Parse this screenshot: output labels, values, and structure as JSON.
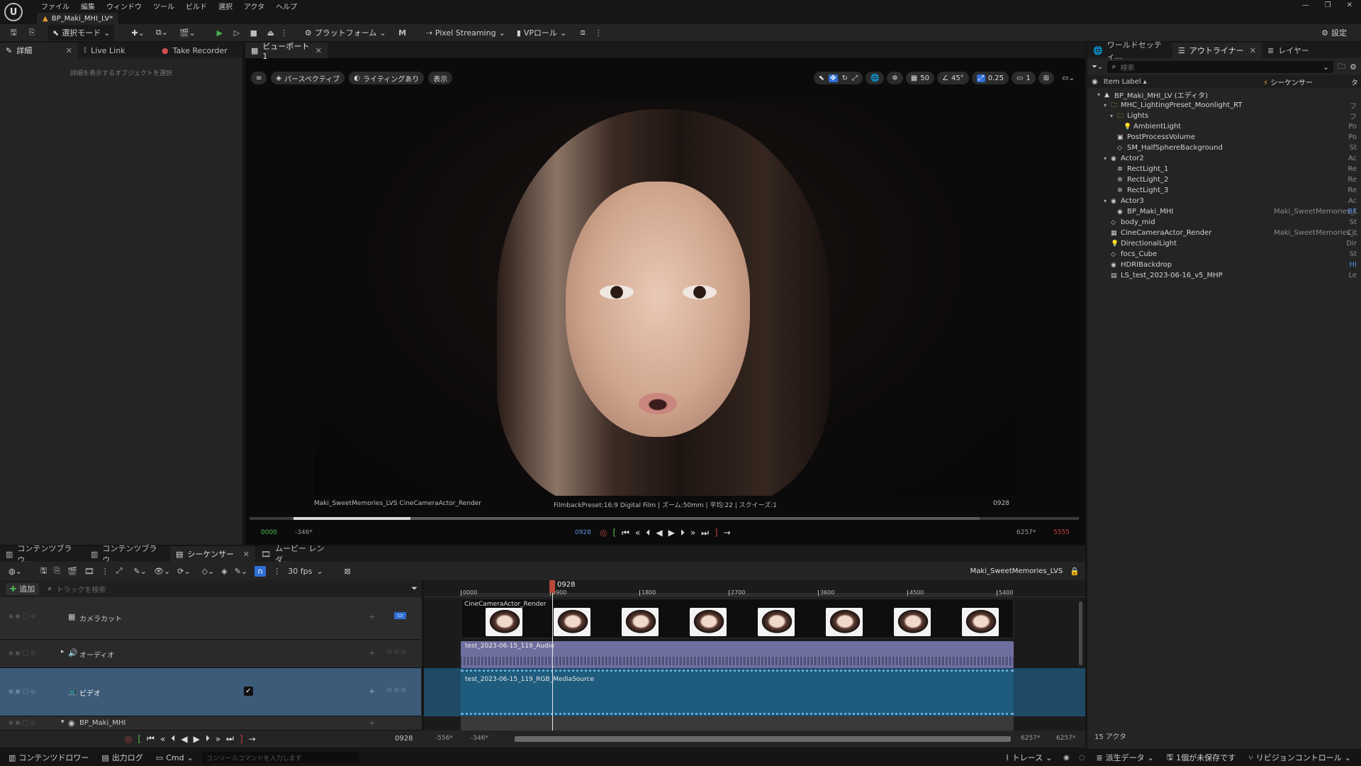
{
  "menu": [
    "ファイル",
    "編集",
    "ウィンドウ",
    "ツール",
    "ビルド",
    "選択",
    "アクタ",
    "ヘルプ"
  ],
  "doc_tab": "BP_Maki_MHI_LV*",
  "toolbar": {
    "select_mode": "選択モード",
    "platform": "プラットフォーム",
    "pixel_streaming": "Pixel Streaming",
    "vp_roll": "VPロール",
    "settings": "設定"
  },
  "left_panel": {
    "tabs": [
      "詳細",
      "Live Link",
      "Take Recorder"
    ],
    "empty_text": "詳細を表示するオブジェクトを選択"
  },
  "viewport": {
    "tab": "ビューポート1",
    "perspective": "パースペクティブ",
    "lighting": "ライティングあり",
    "show": "表示",
    "grid_snap": "50",
    "rot_snap": "45°",
    "scale_snap": "0.25",
    "cam_speed": "1",
    "overlay_left": "Maki_SweetMemories_LVS  CineCameraActor_Render",
    "overlay_center": "FilmbackPreset:16:9 Digital Film | ズーム:50mm | 平均:22 | スクイーズ:1",
    "overlay_right": "0928",
    "frame_start": "0000",
    "frame_view_start": "-346*",
    "current_frame": "0928",
    "frame_view_end": "6257*",
    "frame_end": "5555",
    "scrub_progress": 0.17
  },
  "outliner": {
    "tabs": [
      "ワールドセッティ...",
      "アウトライナー",
      "レイヤー"
    ],
    "search_placeholder": "検索",
    "col_label": "Item Label",
    "col_sequencer": "シーケンサー",
    "col_type": "タ",
    "items": [
      {
        "label": "BP_Maki_MHI_LV (エディタ)",
        "depth": 0,
        "icon": "level",
        "src": "",
        "type": ""
      },
      {
        "label": "MHC_LightingPreset_Moonlight_RT",
        "depth": 1,
        "icon": "folder",
        "src": "",
        "type": "フ"
      },
      {
        "label": "Lights",
        "depth": 2,
        "icon": "folder",
        "src": "",
        "type": "フ"
      },
      {
        "label": "AmbientLight",
        "depth": 3,
        "icon": "light",
        "src": "",
        "type": "Po"
      },
      {
        "label": "PostProcessVolume",
        "depth": 2,
        "icon": "volume",
        "src": "",
        "type": "Po"
      },
      {
        "label": "SM_HalfSphereBackground",
        "depth": 2,
        "icon": "mesh",
        "src": "",
        "type": "St"
      },
      {
        "label": "Actor2",
        "depth": 1,
        "icon": "actor",
        "src": "",
        "type": "Ac"
      },
      {
        "label": "RectLight_1",
        "depth": 2,
        "icon": "rectlight",
        "src": "",
        "type": "Re"
      },
      {
        "label": "RectLight_2",
        "depth": 2,
        "icon": "rectlight",
        "src": "",
        "type": "Re"
      },
      {
        "label": "RectLight_3",
        "depth": 2,
        "icon": "rectlight",
        "src": "",
        "type": "Re"
      },
      {
        "label": "Actor3",
        "depth": 1,
        "icon": "actor",
        "src": "",
        "type": "Ac"
      },
      {
        "label": "BP_Maki_MHI",
        "depth": 2,
        "icon": "actor",
        "src": "Maki_SweetMemories_L",
        "type": "BF"
      },
      {
        "label": "body_mid",
        "depth": 1,
        "icon": "mesh",
        "src": "",
        "type": "St"
      },
      {
        "label": "CineCameraActor_Render",
        "depth": 1,
        "icon": "camera",
        "src": "Maki_SweetMemories_L",
        "type": "Cir"
      },
      {
        "label": "DirectionalLight",
        "depth": 1,
        "icon": "light",
        "src": "",
        "type": "Dir"
      },
      {
        "label": "focs_Cube",
        "depth": 1,
        "icon": "mesh",
        "src": "",
        "type": "St"
      },
      {
        "label": "HDRIBackdrop",
        "depth": 1,
        "icon": "actor",
        "src": "",
        "type": "HI"
      },
      {
        "label": "LS_test_2023-06-16_v5_MHP",
        "depth": 1,
        "icon": "seq",
        "src": "",
        "type": "Le"
      }
    ],
    "actor_count": "15 アクタ"
  },
  "bottom_tabs": [
    "コンテンツブラウ...",
    "コンテンツブラウ...",
    "シーケンサー",
    "ムービー レンダ..."
  ],
  "sequencer": {
    "fps": "30 fps",
    "sequence_name": "Maki_SweetMemories_LVS",
    "add": "追加",
    "search_placeholder": "トラックを検索",
    "tracks": [
      {
        "label": "カメラカット",
        "icon": "camera-cut"
      },
      {
        "label": "オーディオ",
        "icon": "audio"
      },
      {
        "label": "ビデオ",
        "icon": "video"
      },
      {
        "label": "BP_Maki_MHI",
        "icon": "actor"
      }
    ],
    "current_frame": "0928",
    "ruler_labels": [
      "0000",
      "0900",
      "1800",
      "2700",
      "3600",
      "4500",
      "5400"
    ],
    "sections": {
      "camera": "CineCameraActor_Render",
      "audio": "test_2023-06-15_119_Audio",
      "video": "test_2023-06-15_119_RGB_MediaSource"
    },
    "bottom_frame": "0928",
    "range_a": "-556*",
    "range_b": "-346*",
    "range_c": "6257*",
    "range_d": "6257*"
  },
  "status_bar": {
    "content_drawer": "コンテンツドロワー",
    "output_log": "出力ログ",
    "cmd": "Cmd",
    "console_placeholder": "コンソールコマンドを入力します",
    "trace": "トレース",
    "derived_data": "派生データ",
    "unsaved": "1個が未保存です",
    "revision": "リビジョンコントロール"
  },
  "colors": {
    "accent": "#2f6fd6",
    "video_row": "#3c5b78",
    "audio_section": "#6f6f9f",
    "video_section": "#1e5b7d",
    "playhead": "#b8463a"
  }
}
